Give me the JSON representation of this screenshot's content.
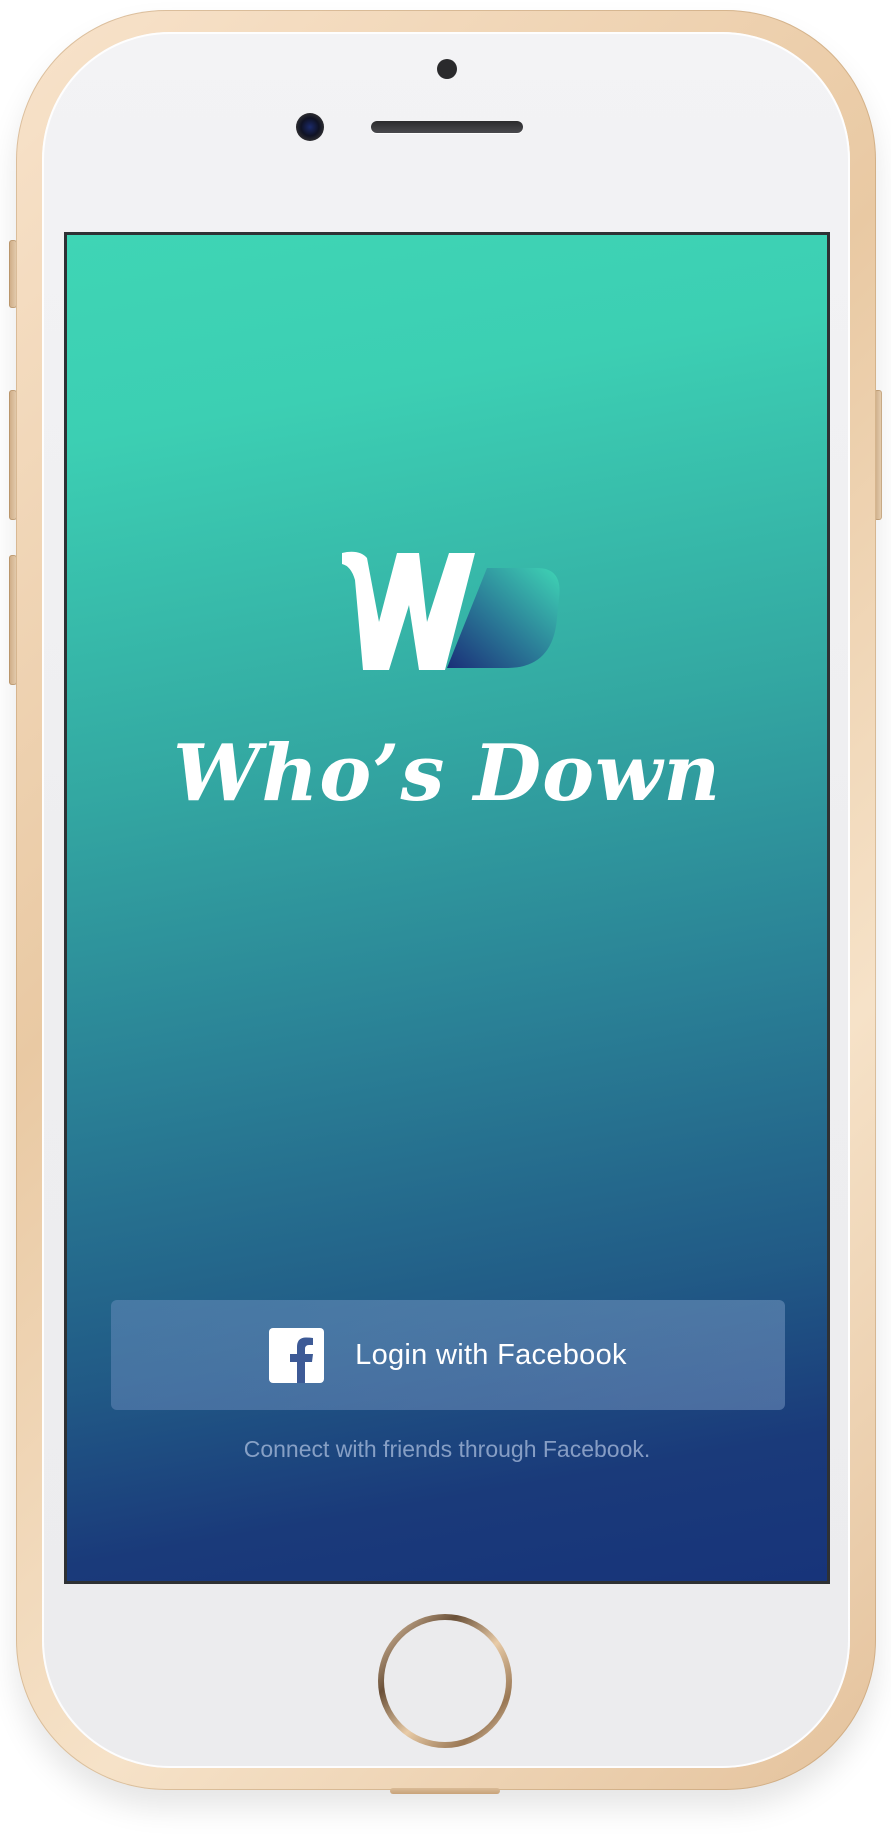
{
  "app": {
    "title": "Who’s Down",
    "logo_icon": "w-logo-icon"
  },
  "login": {
    "button_label": "Login with Facebook",
    "button_icon": "facebook-icon",
    "caption": "Connect with friends through Facebook."
  },
  "theme": {
    "gradient_top": "#3fd5b5",
    "gradient_bottom": "#17347a",
    "device_frame": "#e9c9a3"
  }
}
